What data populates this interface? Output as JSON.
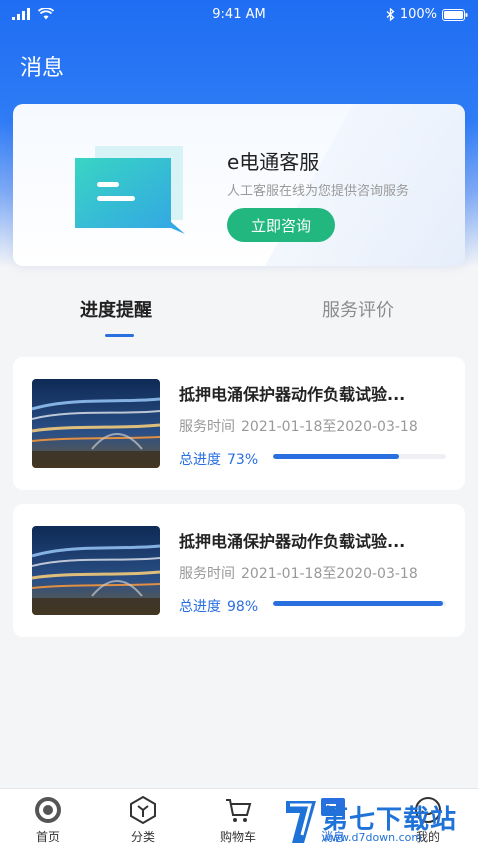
{
  "status_bar": {
    "time": "9:41 AM",
    "battery": "100%"
  },
  "header": {
    "title": "消息"
  },
  "service": {
    "title": "e电通客服",
    "subtitle": "人工客服在线为您提供咨询服务",
    "button_label": "立即咨询"
  },
  "tabs": [
    {
      "label": "进度提醒",
      "active": true
    },
    {
      "label": "服务评价",
      "active": false
    }
  ],
  "orders": [
    {
      "name": "抵押电涌保护器动作负载试验...",
      "date_label": "服务时间",
      "date_range": "2021-01-18至2020-03-18",
      "progress_label": "总进度",
      "progress_text": "73%",
      "progress": 0.73
    },
    {
      "name": "抵押电涌保护器动作负载试验...",
      "date_label": "服务时间",
      "date_range": "2021-01-18至2020-03-18",
      "progress_label": "总进度",
      "progress_text": "98%",
      "progress": 0.98
    }
  ],
  "tabbar": [
    {
      "label": "首页",
      "icon": "home-icon"
    },
    {
      "label": "分类",
      "icon": "category-icon"
    },
    {
      "label": "购物车",
      "icon": "cart-icon"
    },
    {
      "label": "消息",
      "icon": "message-icon"
    },
    {
      "label": "我的",
      "icon": "profile-icon"
    }
  ],
  "watermark": {
    "text": "第七下载站",
    "url": "www.d7down.com"
  },
  "colors": {
    "primary": "#2a6fe0",
    "header": "#1f6df2",
    "accent_green": "#23b780"
  }
}
